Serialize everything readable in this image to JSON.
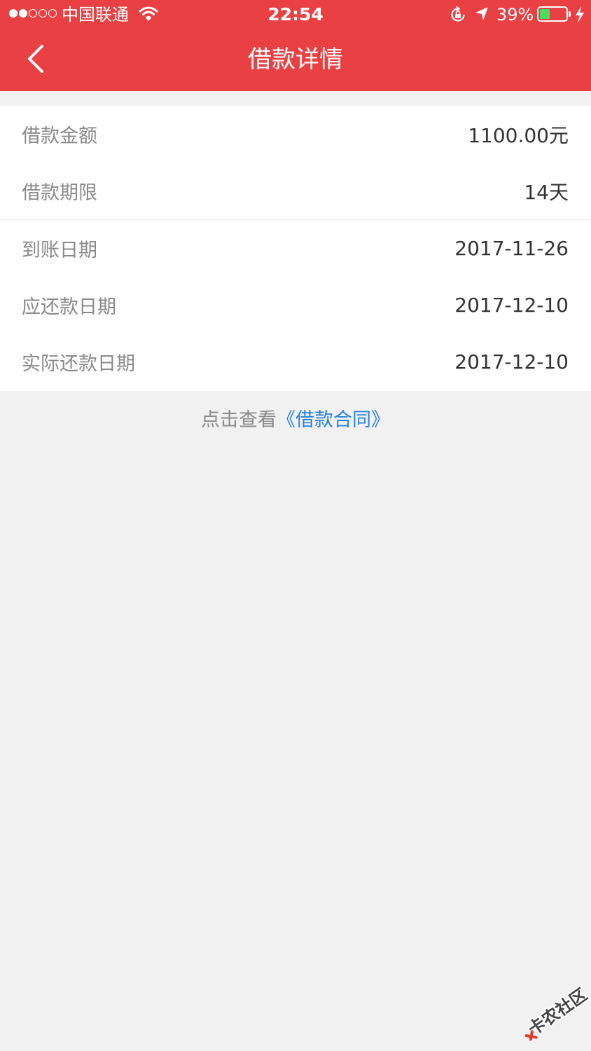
{
  "status_bar": {
    "carrier": "中国联通",
    "time": "22:54",
    "battery": "39%",
    "battery_level": 0.39,
    "signal_bars_filled": 2,
    "signal_bars_total": 5,
    "icons": [
      "wifi-icon",
      "rotation-lock-icon",
      "location-arrow-icon",
      "battery-icon",
      "charging-bolt-icon"
    ]
  },
  "nav": {
    "title": "借款详情",
    "back_icon": "chevron-left-icon"
  },
  "loan_summary": {
    "amount_label": "借款金额",
    "amount_value": "1100.00元",
    "term_label": "借款期限",
    "term_value": "14天"
  },
  "loan_dates": {
    "arrival_label": "到账日期",
    "arrival_value": "2017-11-26",
    "due_label": "应还款日期",
    "due_value": "2017-12-10",
    "actual_label": "实际还款日期",
    "actual_value": "2017-12-10"
  },
  "contract": {
    "prefix": "点击查看",
    "link": "《借款合同》"
  },
  "watermark": {
    "text": "卡农社区"
  },
  "colors": {
    "header": "#e94043",
    "background": "#f1f1f1",
    "link": "#2a82e4",
    "battery_fill": "#4cd964"
  }
}
